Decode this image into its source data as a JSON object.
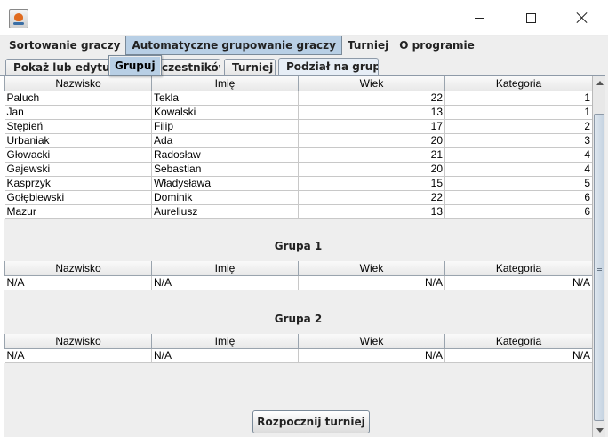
{
  "window": {
    "title": ""
  },
  "menubar": {
    "items": [
      "Sortowanie graczy",
      "Automatyczne grupowanie graczy",
      "Turniej",
      "O programie"
    ]
  },
  "dropdown": {
    "items": [
      "Grupuj"
    ]
  },
  "tabs": [
    "Pokaż lub edytuj do",
    "czestników",
    "Turniej",
    "Podział na grupy"
  ],
  "columns": [
    "Nazwisko",
    "Imię",
    "Wiek",
    "Kategoria"
  ],
  "players": [
    [
      "Paluch",
      "Tekla",
      "22",
      "1"
    ],
    [
      "Jan",
      "Kowalski",
      "13",
      "1"
    ],
    [
      "Stępień",
      "Filip",
      "17",
      "2"
    ],
    [
      "Urbaniak",
      "Ada",
      "20",
      "3"
    ],
    [
      "Głowacki",
      "Radosław",
      "21",
      "4"
    ],
    [
      "Gajewski",
      "Sebastian",
      "20",
      "4"
    ],
    [
      "Kasprzyk",
      "Władysława",
      "15",
      "5"
    ],
    [
      "Gołębiewski",
      "Dominik",
      "22",
      "6"
    ],
    [
      "Mazur",
      "Aureliusz",
      "13",
      "6"
    ]
  ],
  "groups": [
    {
      "title": "Grupa 1",
      "rows": [
        [
          "N/A",
          "N/A",
          "N/A",
          "N/A"
        ]
      ]
    },
    {
      "title": "Grupa 2",
      "rows": [
        [
          "N/A",
          "N/A",
          "N/A",
          "N/A"
        ]
      ]
    }
  ],
  "start_button": "Rozpocznij turniej",
  "colors": {
    "menu_highlight": "#b8cfe5",
    "tab_selected": "#e7eef6",
    "panel_bg": "#eeeeee"
  }
}
